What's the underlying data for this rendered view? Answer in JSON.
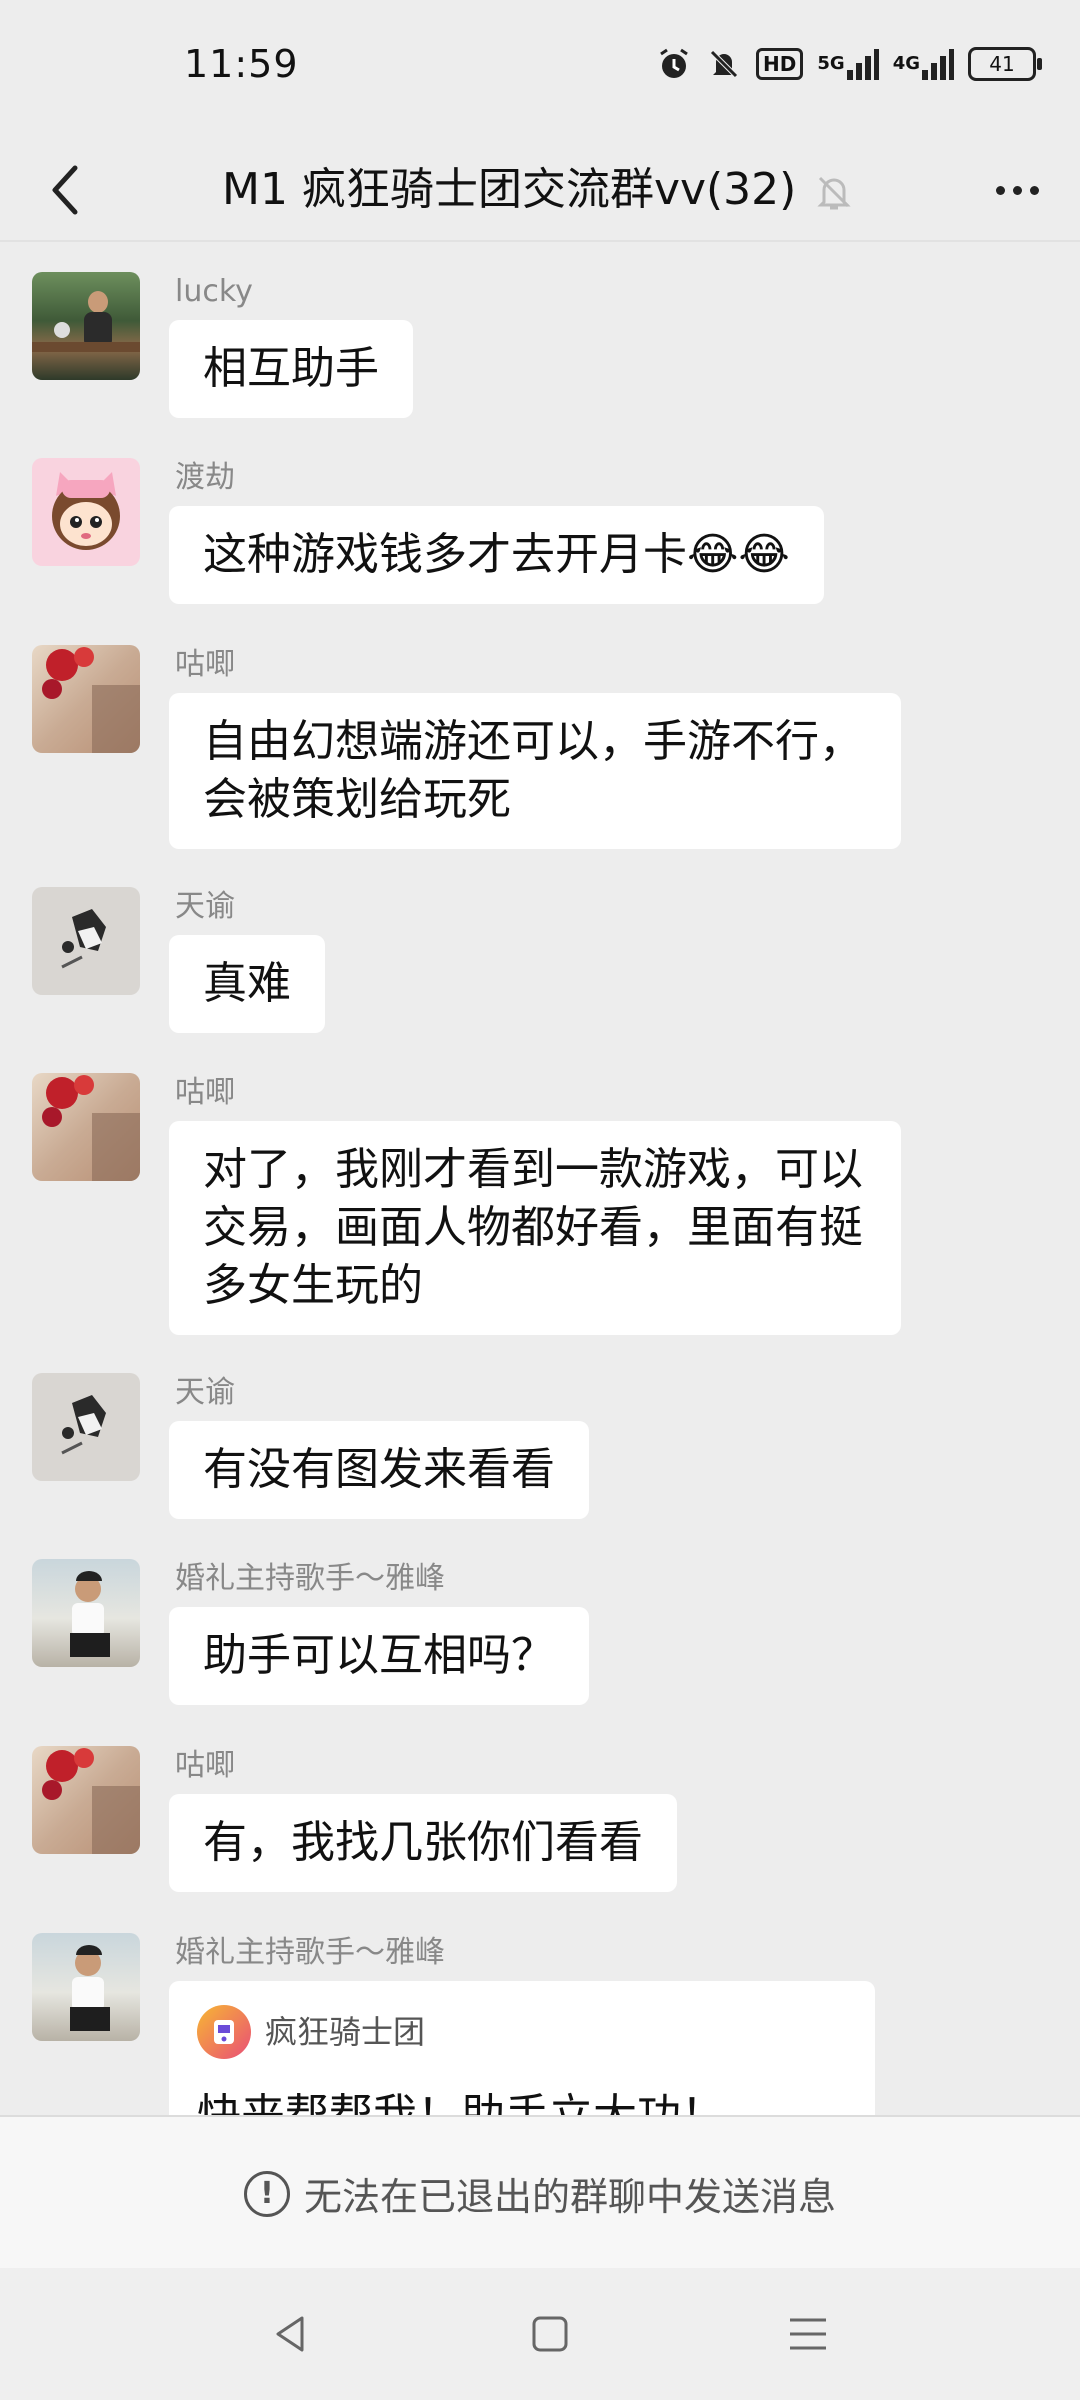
{
  "status": {
    "time": "11:59",
    "hd": "HD",
    "net1": "5G",
    "net2": "4G",
    "battery": "41"
  },
  "header": {
    "title": "M1 疯狂骑士团交流群vv(32)"
  },
  "messages": [
    {
      "sender": "lucky",
      "text": "相互助手"
    },
    {
      "sender": "渡劫",
      "text": "这种游戏钱多才去开月卡😂😂"
    },
    {
      "sender": "咕唧",
      "text": "自由幻想端游还可以，手游不行，会被策划给玩死"
    },
    {
      "sender": "天谕",
      "text": "真难"
    },
    {
      "sender": "咕唧",
      "text": "对了，我刚才看到一款游戏，可以交易，画面人物都好看，里面有挺多女生玩的"
    },
    {
      "sender": "天谕",
      "text": "有没有图发来看看"
    },
    {
      "sender": "婚礼主持歌手～雅峰",
      "text": "助手可以互相吗？"
    },
    {
      "sender": "咕唧",
      "text": "有，我找几张你们看看"
    },
    {
      "sender": "婚礼主持歌手～雅峰",
      "card_app": "疯狂骑士团",
      "card_title": "快来帮帮我！助手立大功！"
    }
  ],
  "input": {
    "notice": "无法在已退出的群聊中发送消息"
  },
  "colors": {
    "background": "#ededed",
    "bubble": "#ffffff",
    "sender": "#888888"
  }
}
